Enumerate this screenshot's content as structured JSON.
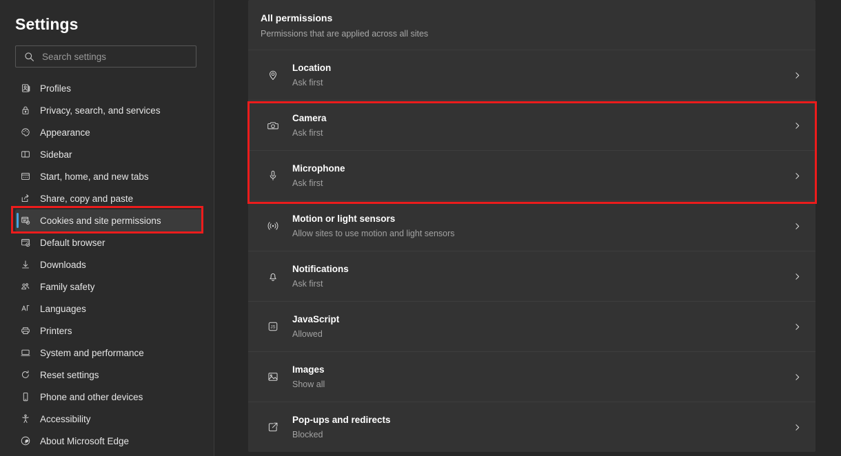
{
  "sidebar": {
    "title": "Settings",
    "search": {
      "placeholder": "Search settings",
      "value": "",
      "icon": "search-icon"
    },
    "items": [
      {
        "label": "Profiles",
        "icon": "profiles-icon",
        "selected": false
      },
      {
        "label": "Privacy, search, and services",
        "icon": "lock-icon",
        "selected": false
      },
      {
        "label": "Appearance",
        "icon": "palette-icon",
        "selected": false
      },
      {
        "label": "Sidebar",
        "icon": "sidebar-icon",
        "selected": false
      },
      {
        "label": "Start, home, and new tabs",
        "icon": "browser-icon",
        "selected": false
      },
      {
        "label": "Share, copy and paste",
        "icon": "share-icon",
        "selected": false
      },
      {
        "label": "Cookies and site permissions",
        "icon": "cookies-icon",
        "selected": true
      },
      {
        "label": "Default browser",
        "icon": "default-browser-icon",
        "selected": false
      },
      {
        "label": "Downloads",
        "icon": "download-icon",
        "selected": false
      },
      {
        "label": "Family safety",
        "icon": "family-icon",
        "selected": false
      },
      {
        "label": "Languages",
        "icon": "languages-icon",
        "selected": false
      },
      {
        "label": "Printers",
        "icon": "printer-icon",
        "selected": false
      },
      {
        "label": "System and performance",
        "icon": "system-icon",
        "selected": false
      },
      {
        "label": "Reset settings",
        "icon": "reset-icon",
        "selected": false
      },
      {
        "label": "Phone and other devices",
        "icon": "phone-icon",
        "selected": false
      },
      {
        "label": "Accessibility",
        "icon": "accessibility-icon",
        "selected": false
      },
      {
        "label": "About Microsoft Edge",
        "icon": "edge-icon",
        "selected": false
      }
    ]
  },
  "main": {
    "heading": "All permissions",
    "subheading": "Permissions that are applied across all sites",
    "permissions": [
      {
        "title": "Location",
        "status": "Ask first",
        "icon": "location-icon",
        "chevron": "›"
      },
      {
        "title": "Camera",
        "status": "Ask first",
        "icon": "camera-icon",
        "chevron": "›"
      },
      {
        "title": "Microphone",
        "status": "Ask first",
        "icon": "microphone-icon",
        "chevron": "›"
      },
      {
        "title": "Motion or light sensors",
        "status": "Allow sites to use motion and light sensors",
        "icon": "motion-sensor-icon",
        "chevron": "›"
      },
      {
        "title": "Notifications",
        "status": "Ask first",
        "icon": "bell-icon",
        "chevron": "›"
      },
      {
        "title": "JavaScript",
        "status": "Allowed",
        "icon": "javascript-icon",
        "chevron": "›"
      },
      {
        "title": "Images",
        "status": "Show all",
        "icon": "image-icon",
        "chevron": "›"
      },
      {
        "title": "Pop-ups and redirects",
        "status": "Blocked",
        "icon": "popup-icon",
        "chevron": "›"
      }
    ]
  },
  "annotations": {
    "highlight_color": "#ec1c1c",
    "selection_bar_color": "#4aa3e0",
    "boxes": [
      {
        "target": "Cookies and site permissions"
      },
      {
        "target": "Camera and Microphone"
      }
    ]
  }
}
